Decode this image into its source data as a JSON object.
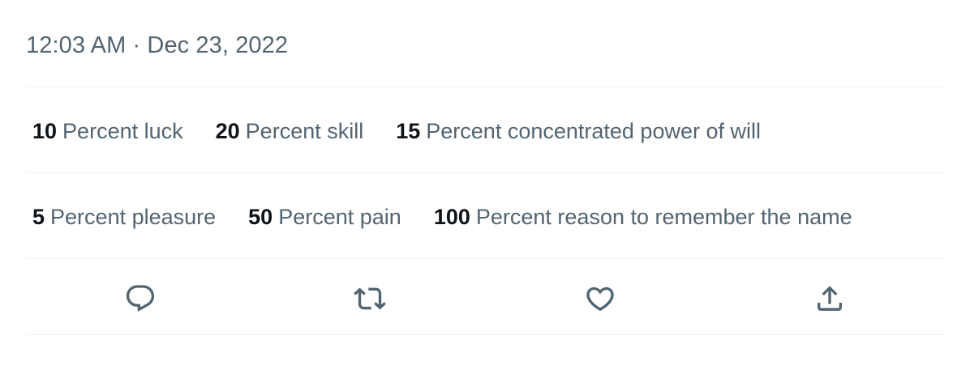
{
  "tweet": {
    "timestamp": "12:03 AM · Dec 23, 2022"
  },
  "stats_rows": [
    [
      {
        "value": "10",
        "label": "Percent luck"
      },
      {
        "value": "20",
        "label": "Percent skill"
      },
      {
        "value": "15",
        "label": "Percent concentrated power of will"
      }
    ],
    [
      {
        "value": "5",
        "label": "Percent pleasure"
      },
      {
        "value": "50",
        "label": "Percent pain"
      },
      {
        "value": "100",
        "label": "Percent reason to remember the name"
      }
    ]
  ],
  "actions": [
    {
      "name": "reply",
      "icon": "reply-icon"
    },
    {
      "name": "retweet",
      "icon": "retweet-icon"
    },
    {
      "name": "like",
      "icon": "heart-icon"
    },
    {
      "name": "share",
      "icon": "share-icon"
    }
  ],
  "colors": {
    "text_primary": "#0f1419",
    "text_secondary": "#536471",
    "divider": "#eff3f4"
  }
}
